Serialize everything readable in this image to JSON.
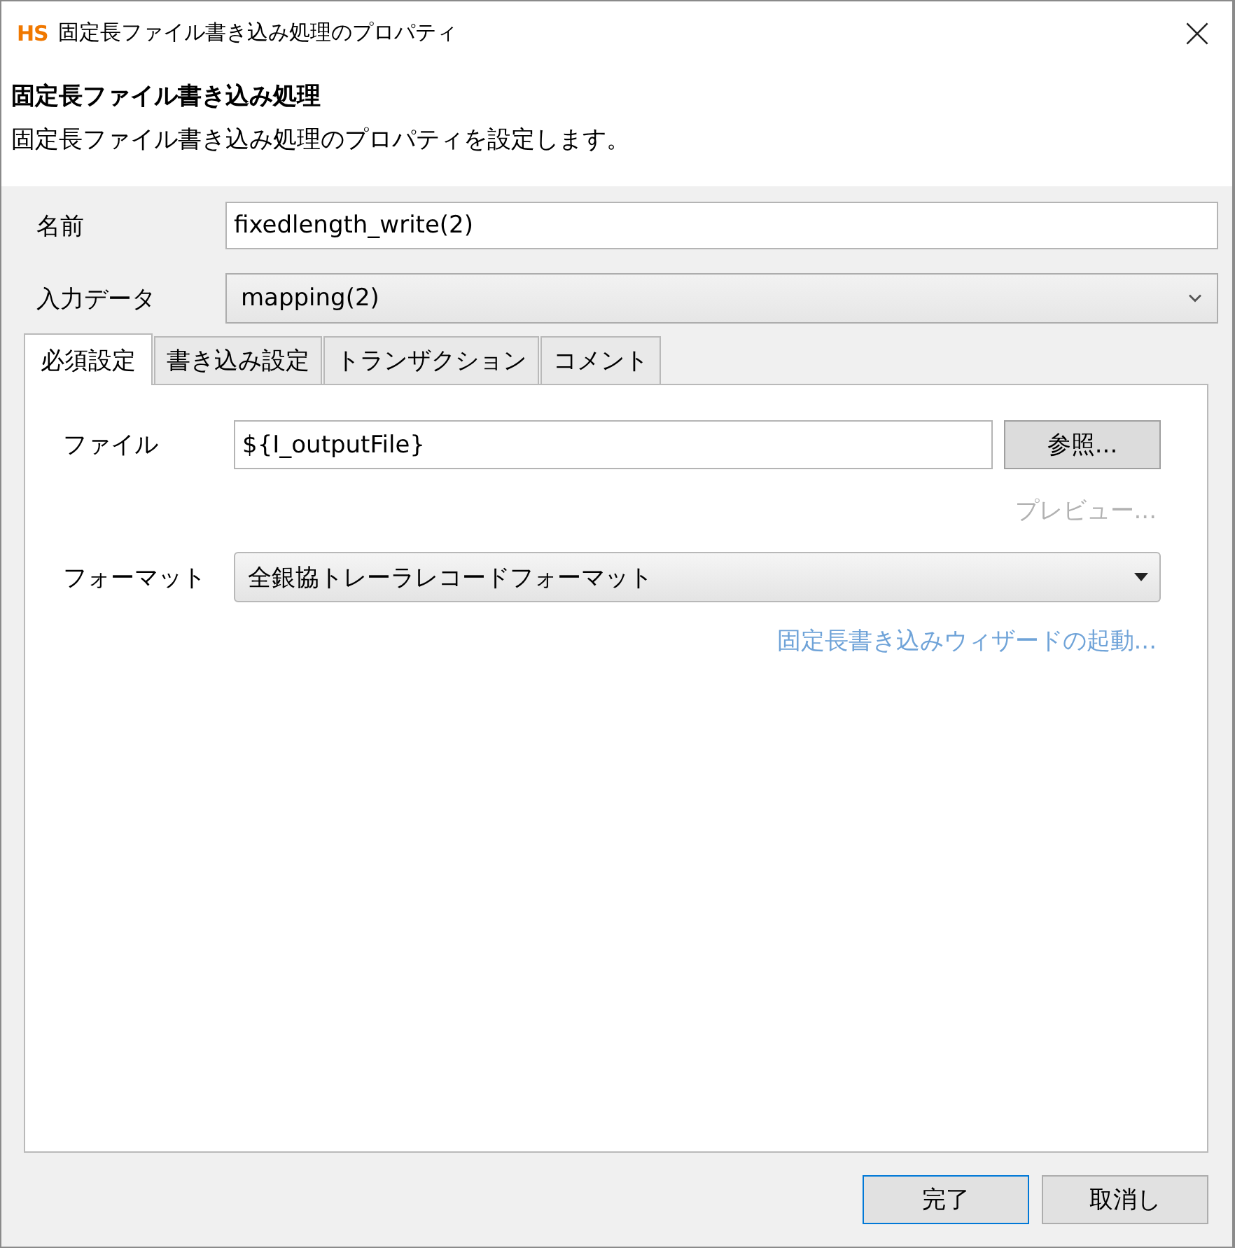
{
  "window": {
    "logo": "HS",
    "title": "固定長ファイル書き込み処理のプロパティ"
  },
  "header": {
    "title": "固定長ファイル書き込み処理",
    "description": "固定長ファイル書き込み処理のプロパティを設定します。"
  },
  "fields": [
    {
      "kind": "text",
      "label": "名前",
      "value": "fixedlength_write(2)"
    },
    {
      "kind": "combo",
      "label": "入力データ",
      "value": "mapping(2)"
    }
  ],
  "tabs": [
    {
      "label": "必須設定",
      "selected": true
    },
    {
      "label": "書き込み設定",
      "selected": false
    },
    {
      "label": "トランザクション",
      "selected": false
    },
    {
      "label": "コメント",
      "selected": false
    }
  ],
  "panel": {
    "file": {
      "label": "ファイル",
      "value": "${I_outputFile}",
      "button": "参照..."
    },
    "preview_link": {
      "label": "プレビュー...",
      "disabled": true
    },
    "format": {
      "label": "フォーマット",
      "value": "全銀協トレーラレコードフォーマット"
    },
    "wizard_link": {
      "label": "固定長書き込みウィザードの起動...",
      "disabled": false
    }
  },
  "buttons": [
    {
      "label": "完了",
      "default": true
    },
    {
      "label": "取消し",
      "default": false
    }
  ]
}
